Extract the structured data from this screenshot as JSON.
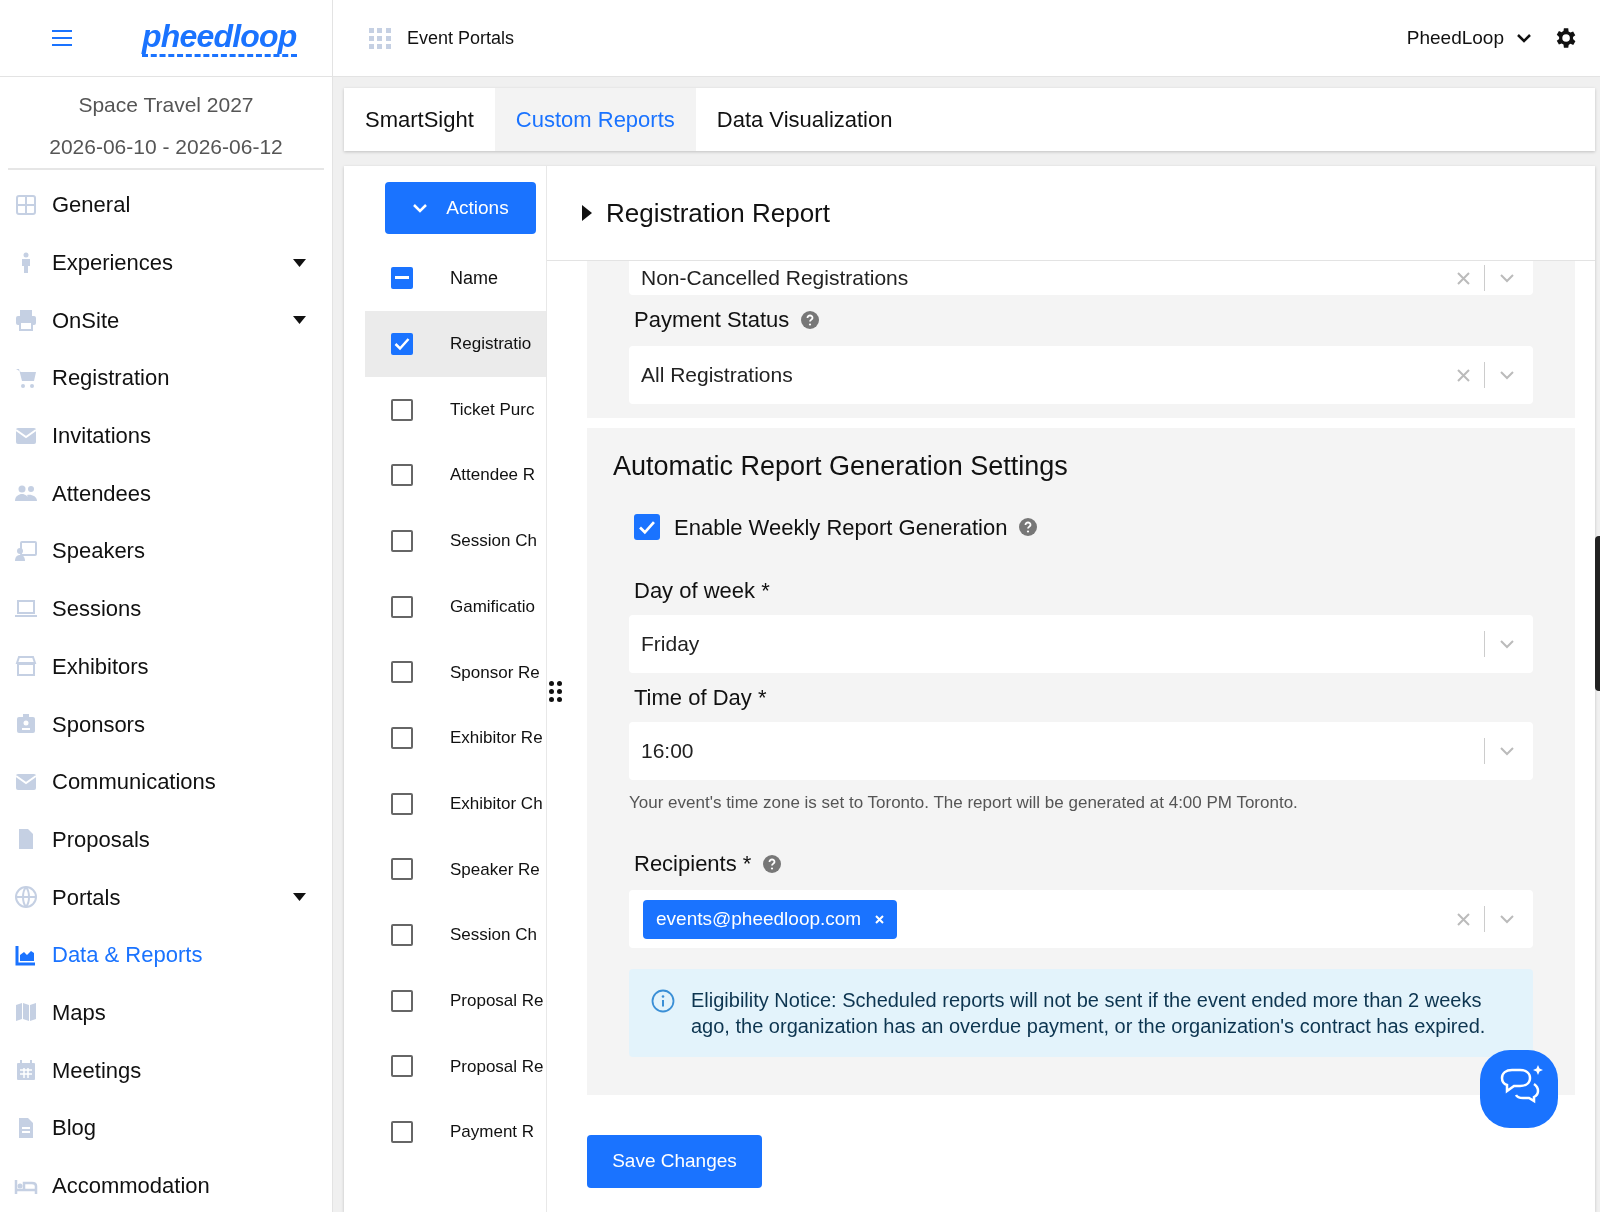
{
  "header": {
    "logo": "pheedloop",
    "app_title": "Event Portals",
    "account": "PheedLoop"
  },
  "sidebar": {
    "event_name": "Space Travel 2027",
    "event_dates": "2026-06-10 - 2026-06-12",
    "items": [
      {
        "label": "General",
        "selected": false,
        "expandable": false
      },
      {
        "label": "Experiences",
        "selected": false,
        "expandable": true
      },
      {
        "label": "OnSite",
        "selected": false,
        "expandable": true
      },
      {
        "label": "Registration",
        "selected": false,
        "expandable": false
      },
      {
        "label": "Invitations",
        "selected": false,
        "expandable": false
      },
      {
        "label": "Attendees",
        "selected": false,
        "expandable": false
      },
      {
        "label": "Speakers",
        "selected": false,
        "expandable": false
      },
      {
        "label": "Sessions",
        "selected": false,
        "expandable": false
      },
      {
        "label": "Exhibitors",
        "selected": false,
        "expandable": false
      },
      {
        "label": "Sponsors",
        "selected": false,
        "expandable": false
      },
      {
        "label": "Communications",
        "selected": false,
        "expandable": false
      },
      {
        "label": "Proposals",
        "selected": false,
        "expandable": false
      },
      {
        "label": "Portals",
        "selected": false,
        "expandable": true
      },
      {
        "label": "Data & Reports",
        "selected": true,
        "expandable": false
      },
      {
        "label": "Maps",
        "selected": false,
        "expandable": false
      },
      {
        "label": "Meetings",
        "selected": false,
        "expandable": false
      },
      {
        "label": "Blog",
        "selected": false,
        "expandable": false
      },
      {
        "label": "Accommodation",
        "selected": false,
        "expandable": false
      }
    ]
  },
  "tabs": [
    {
      "label": "SmartSight",
      "selected": false
    },
    {
      "label": "Custom Reports",
      "selected": true
    },
    {
      "label": "Data Visualization",
      "selected": false
    }
  ],
  "report_list": {
    "actions_label": "Actions",
    "column": "Name",
    "select_all_indeterminate": true,
    "rows": [
      {
        "name": "Registratio",
        "checked": true,
        "selected": true
      },
      {
        "name": "Ticket Purc",
        "checked": false,
        "selected": false
      },
      {
        "name": "Attendee R",
        "checked": false,
        "selected": false
      },
      {
        "name": "Session Ch",
        "checked": false,
        "selected": false
      },
      {
        "name": "Gamificatio",
        "checked": false,
        "selected": false
      },
      {
        "name": "Sponsor Re",
        "checked": false,
        "selected": false
      },
      {
        "name": "Exhibitor Re",
        "checked": false,
        "selected": false
      },
      {
        "name": "Exhibitor Ch",
        "checked": false,
        "selected": false
      },
      {
        "name": "Speaker Re",
        "checked": false,
        "selected": false
      },
      {
        "name": "Session Ch",
        "checked": false,
        "selected": false
      },
      {
        "name": "Proposal Re",
        "checked": false,
        "selected": false
      },
      {
        "name": "Proposal Re",
        "checked": false,
        "selected": false
      },
      {
        "name": "Payment R",
        "checked": false,
        "selected": false
      }
    ]
  },
  "report": {
    "title": "Registration Report",
    "expanded": false,
    "filters": [
      {
        "value": "Non-Cancelled Registrations",
        "clearable": true
      },
      {
        "label": "Payment Status",
        "help": true,
        "value": "All Registrations",
        "clearable": true
      }
    ],
    "automatic": {
      "title": "Automatic Report Generation Settings",
      "enable": {
        "label": "Enable Weekly Report Generation",
        "checked": true,
        "help": true
      },
      "fields": [
        {
          "label": "Day of week *",
          "value": "Friday",
          "clearable": false
        },
        {
          "label": "Time of Day *",
          "value": "16:00",
          "clearable": false
        }
      ],
      "timezone_note": "Your event's time zone is set to Toronto. The report will be generated at 4:00 PM Toronto.",
      "recipients": {
        "label": "Recipients *",
        "help": true,
        "tags": [
          "events@pheedloop.com"
        ],
        "clearable": true
      },
      "notice": "Eligibility Notice: Scheduled reports will not be sent if the event ended more than 2 weeks ago, the organization has an overdue payment, or the organization's contract has expired."
    },
    "save_label": "Save Changes"
  }
}
